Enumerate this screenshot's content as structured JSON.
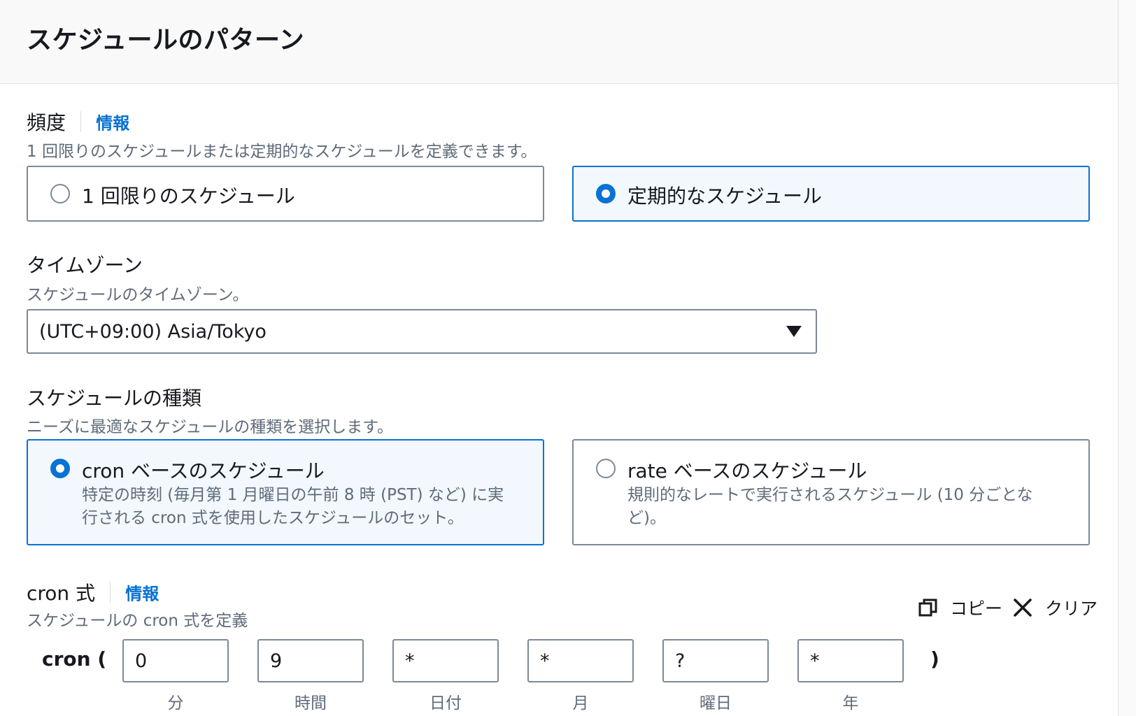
{
  "header": {
    "title": "スケジュールのパターン"
  },
  "frequency": {
    "label": "頻度",
    "info": "情報",
    "description": "1 回限りのスケジュールまたは定期的なスケジュールを定義できます。",
    "options": [
      {
        "label": "1 回限りのスケジュール",
        "selected": false
      },
      {
        "label": "定期的なスケジュール",
        "selected": true
      }
    ]
  },
  "timezone": {
    "label": "タイムゾーン",
    "description": "スケジュールのタイムゾーン。",
    "value": "(UTC+09:00) Asia/Tokyo"
  },
  "schedule_type": {
    "label": "スケジュールの種類",
    "description": "ニーズに最適なスケジュールの種類を選択します。",
    "options": [
      {
        "label": "cron ベースのスケジュール",
        "desc_line1": "特定の時刻 (毎月第 1 月曜日の午前 8 時 (PST) など) に実",
        "desc_line2": "行される cron 式を使用したスケジュールのセット。",
        "selected": true
      },
      {
        "label": "rate ベースのスケジュール",
        "desc_line1": "規則的なレートで実行されるスケジュール (10 分ごとな",
        "desc_line2": "ど)。",
        "selected": false
      }
    ]
  },
  "cron": {
    "label": "cron 式",
    "info": "情報",
    "description": "スケジュールの cron 式を定義",
    "copy_label": "コピー",
    "clear_label": "クリア",
    "prefix": "cron (",
    "suffix": ")",
    "fields": [
      {
        "value": "0",
        "label": "分"
      },
      {
        "value": "9",
        "label": "時間"
      },
      {
        "value": "*",
        "label": "日付"
      },
      {
        "value": "*",
        "label": "月"
      },
      {
        "value": "?",
        "label": "曜日"
      },
      {
        "value": "*",
        "label": "年"
      }
    ]
  },
  "colors": {
    "accent": "#0972d3",
    "selected_bg": "#f2f8fd",
    "border": "#7d8998",
    "text": "#16191f",
    "muted": "#5f6b7a"
  },
  "icons": {
    "copy": "copy-icon",
    "clear": "close-icon",
    "dropdown": "caret-down-icon"
  }
}
